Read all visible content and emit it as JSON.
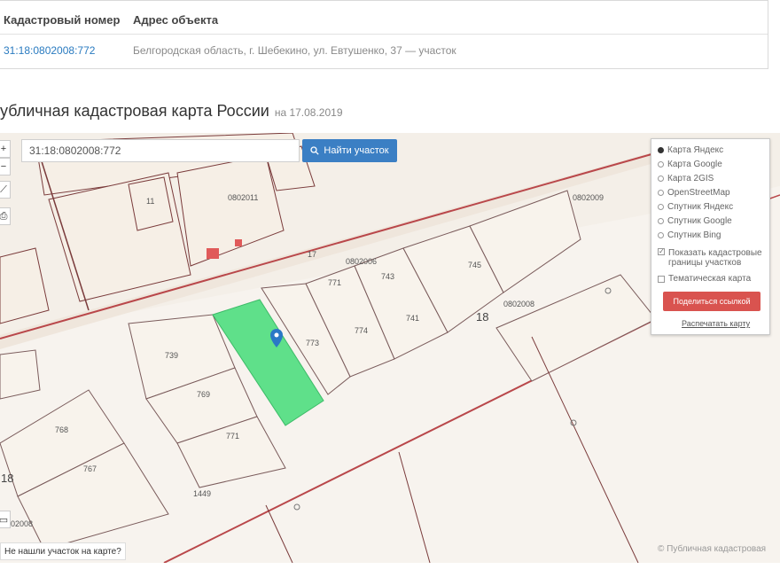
{
  "table": {
    "headers": [
      "Кадастровый номер",
      "Адрес объекта"
    ],
    "cadastral_number": "31:18:0802008:772",
    "address": "Белгородская область, г. Шебекино, ул. Евтушенко, 37 — участок"
  },
  "map": {
    "title": "убличная кадастровая карта России",
    "date": "на 17.08.2019",
    "search_value": "31:18:0802008:772",
    "search_button": "Найти участок",
    "quarters": [
      "0802011",
      "0802006",
      "0802008",
      "0802009",
      "0802008"
    ],
    "parcel_labels": [
      "11",
      "17",
      "771",
      "774",
      "743",
      "745",
      "741",
      "739",
      "769",
      "773",
      "771",
      "768",
      "767",
      "1449",
      "18",
      "18"
    ],
    "missing_link": "Не нашли участок на карте?",
    "copyright": "© Публичная кадастровая"
  },
  "layers": {
    "options": [
      "Карта Яндекс",
      "Карта Google",
      "Карта 2GIS",
      "OpenStreetMap",
      "Спутник Яндекс",
      "Спутник Google",
      "Спутник Bing"
    ],
    "selected": "Карта Яндекс",
    "check_cadastral": "Показать кадастровые границы участков",
    "check_thematic": "Тематическая карта",
    "share_button": "Поделиться ссылкой",
    "print_link": "Распечатать карту"
  },
  "colors": {
    "selected_parcel": "#5fe08a",
    "boundary_red": "#c8454a",
    "map_bg": "#f4efe8",
    "button_blue": "#3b7fc4",
    "button_red": "#d9534f"
  }
}
